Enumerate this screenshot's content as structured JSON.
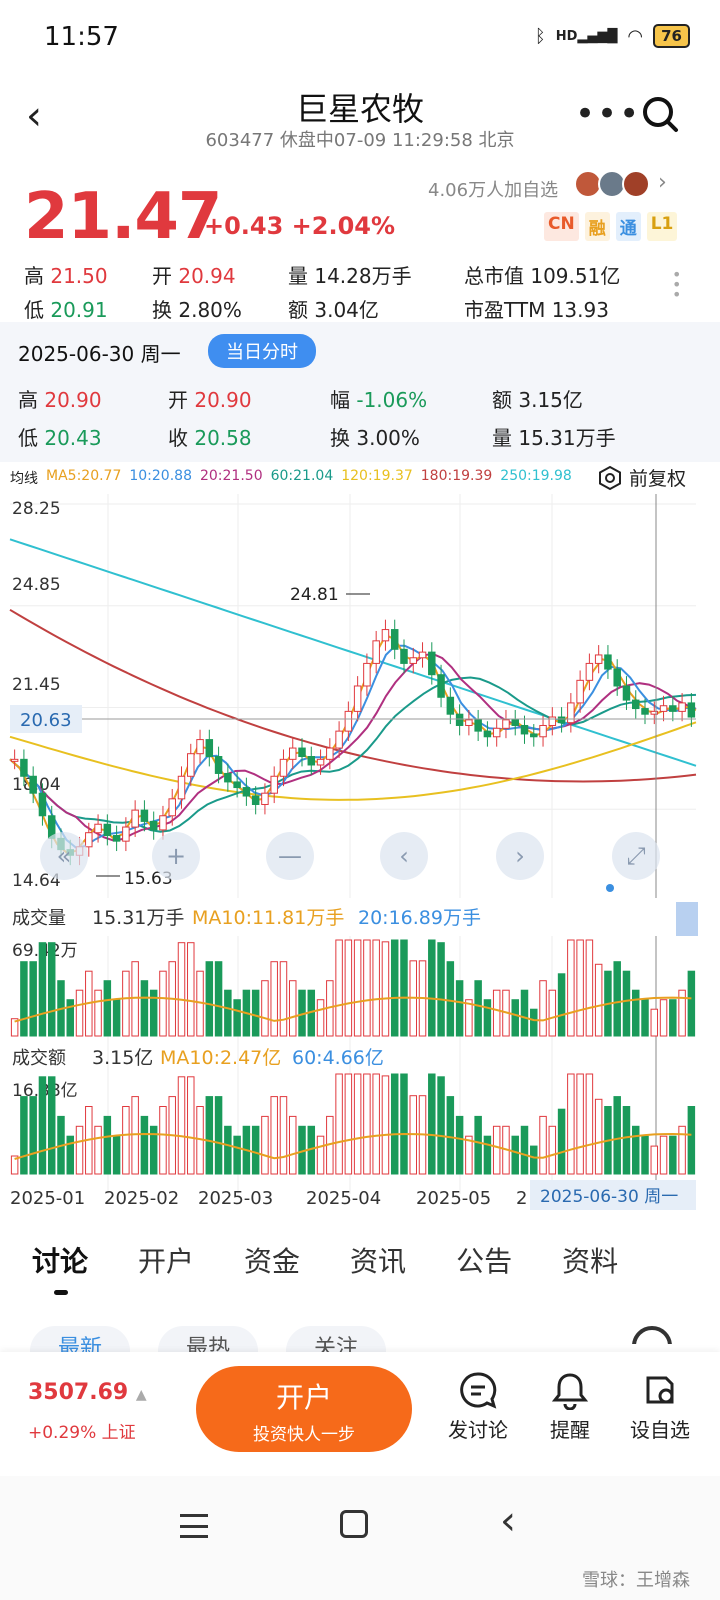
{
  "status": {
    "time": "11:57",
    "battery": "76",
    "hd": "HD"
  },
  "header": {
    "title": "巨星农牧",
    "subtitle": "603477 休盘中07-09 11:29:58 北京"
  },
  "quote": {
    "price": "21.47",
    "change": "+0.43  +2.04%",
    "watch": "4.06万人加自选",
    "tags": [
      {
        "t": "CN",
        "c": "#e85a2a",
        "bg": "#fde8e0"
      },
      {
        "t": "融",
        "c": "#e8a020",
        "bg": "#fdf2de"
      },
      {
        "t": "通",
        "c": "#3b8fe0",
        "bg": "#e3effc"
      },
      {
        "t": "L1",
        "c": "#d8a010",
        "bg": "#fdf5d8"
      }
    ],
    "rows": [
      [
        {
          "k": "高",
          "v": "21.50",
          "cls": "up"
        },
        {
          "k": "开",
          "v": "20.94",
          "cls": "up"
        },
        {
          "k": "量",
          "v": "14.28万手",
          "cls": ""
        },
        {
          "k": "总市值",
          "v": "109.51亿",
          "cls": ""
        }
      ],
      [
        {
          "k": "低",
          "v": "20.91",
          "cls": "dn"
        },
        {
          "k": "换",
          "v": "2.80%",
          "cls": ""
        },
        {
          "k": "额",
          "v": "3.04亿",
          "cls": ""
        },
        {
          "k": "市盈TTM",
          "v": "13.93",
          "cls": ""
        }
      ]
    ]
  },
  "day": {
    "date": "2025-06-30 周一",
    "pill": "当日分时",
    "rows": [
      [
        {
          "k": "高",
          "v": "20.90",
          "cls": "up"
        },
        {
          "k": "开",
          "v": "20.90",
          "cls": "up"
        },
        {
          "k": "幅",
          "v": "-1.06%",
          "cls": "dn"
        },
        {
          "k": "额",
          "v": "3.15亿",
          "cls": ""
        }
      ],
      [
        {
          "k": "低",
          "v": "20.43",
          "cls": "dn"
        },
        {
          "k": "收",
          "v": "20.58",
          "cls": "dn"
        },
        {
          "k": "换",
          "v": "3.00%",
          "cls": ""
        },
        {
          "k": "量",
          "v": "15.31万手",
          "cls": ""
        }
      ]
    ]
  },
  "ma": [
    {
      "t": "均线",
      "c": "#222"
    },
    {
      "t": "MA5:20.77",
      "c": "#e8a020"
    },
    {
      "t": "10:20.88",
      "c": "#3b8fe0"
    },
    {
      "t": "20:21.50",
      "c": "#b03080"
    },
    {
      "t": "60:21.04",
      "c": "#1a9a8a"
    },
    {
      "t": "120:19.37",
      "c": "#e8c020"
    },
    {
      "t": "180:19.39",
      "c": "#c04040"
    },
    {
      "t": "250:19.98",
      "c": "#30c0d0"
    }
  ],
  "fq": "前复权",
  "chart_data": {
    "type": "candlestick",
    "price_axis": [
      "28.25",
      "24.85",
      "21.45",
      "18.04",
      "14.64"
    ],
    "current_label": "20.63",
    "high_label": "24.81",
    "low_label": "15.63",
    "volume": {
      "label": "成交量",
      "value": "15.31万手",
      "ma10": "MA10:11.81万手",
      "ma20": "20:16.89万手",
      "max": "69.42万"
    },
    "amount": {
      "label": "成交额",
      "value": "3.15亿",
      "ma10": "MA10:2.47亿",
      "ma60": "60:4.66亿",
      "max": "16.38亿"
    },
    "x_labels": [
      "2025-01",
      "2025-02",
      "2025-03",
      "2025-04",
      "2025-05",
      "2"
    ],
    "cursor_date": "2025-06-30 周一",
    "closes": [
      19.2,
      18.6,
      18.0,
      17.2,
      16.4,
      16.0,
      15.8,
      16.1,
      16.6,
      16.9,
      16.5,
      16.3,
      16.8,
      17.4,
      17.0,
      16.7,
      17.2,
      17.8,
      18.6,
      19.4,
      19.9,
      19.3,
      18.7,
      18.4,
      18.2,
      17.9,
      17.6,
      18.0,
      18.6,
      19.2,
      19.6,
      19.3,
      19.0,
      19.2,
      19.6,
      20.2,
      20.9,
      21.8,
      22.6,
      23.4,
      23.8,
      23.1,
      22.6,
      22.8,
      23.0,
      22.2,
      21.4,
      20.8,
      20.4,
      20.6,
      20.2,
      20.0,
      20.3,
      20.6,
      20.4,
      20.1,
      20.0,
      20.4,
      20.7,
      20.5,
      21.2,
      22.0,
      22.6,
      22.9,
      22.4,
      21.8,
      21.3,
      21.0,
      20.8,
      20.9,
      21.1,
      20.9,
      21.2,
      20.7
    ]
  },
  "tabs": [
    "讨论",
    "开户",
    "资金",
    "资讯",
    "公告",
    "资料"
  ],
  "subtabs": [
    "最新",
    "最热",
    "关注"
  ],
  "bottom": {
    "index": "3507.69",
    "index_chg": "+0.29% 上证",
    "open": "开户",
    "open_sub": "投资快人一步",
    "actions": [
      "发讨论",
      "提醒",
      "设自选"
    ]
  },
  "watermark": "雪球：王增森"
}
